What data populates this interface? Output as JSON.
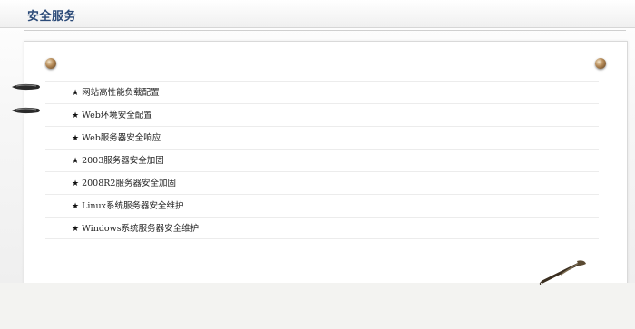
{
  "header": {
    "title": "安全服务"
  },
  "menu": {
    "star_symbol": "★",
    "items": [
      {
        "label": "网站高性能负载配置"
      },
      {
        "label": "Web环境安全配置"
      },
      {
        "label": "Web服务器安全响应"
      },
      {
        "label": "2003服务器安全加固"
      },
      {
        "label": "2008R2服务器安全加固"
      },
      {
        "label": "Linux系统服务器安全维护"
      },
      {
        "label": "Windows系统服务器安全维护"
      }
    ]
  },
  "colors": {
    "title": "#2b4a78",
    "text": "#222222",
    "divider": "#ececec"
  }
}
